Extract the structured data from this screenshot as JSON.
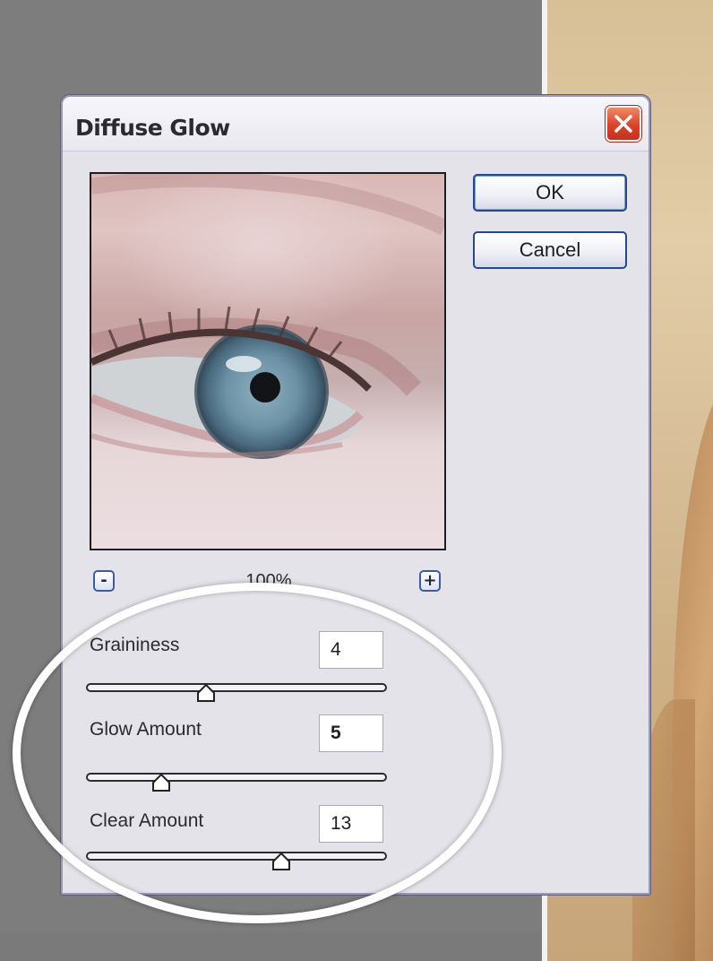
{
  "dialog": {
    "title": "Diffuse Glow",
    "close_icon": "close-icon",
    "ok_label": "OK",
    "cancel_label": "Cancel"
  },
  "preview": {
    "zoom_level": "100%",
    "zoom_out_label": "-",
    "zoom_in_label": "+"
  },
  "params": [
    {
      "label": "Graininess",
      "value": "4",
      "slider_min": 0,
      "slider_max": 10,
      "slider_value": 4
    },
    {
      "label": "Glow Amount",
      "value": "5",
      "slider_min": 0,
      "slider_max": 20,
      "slider_value": 5
    },
    {
      "label": "Clear Amount",
      "value": "13",
      "slider_min": 0,
      "slider_max": 20,
      "slider_value": 13
    }
  ],
  "colors": {
    "close_button": "#d9432a",
    "button_border": "#244a8e",
    "dialog_bg": "#e4e3ea",
    "highlight": "#ffffff"
  }
}
